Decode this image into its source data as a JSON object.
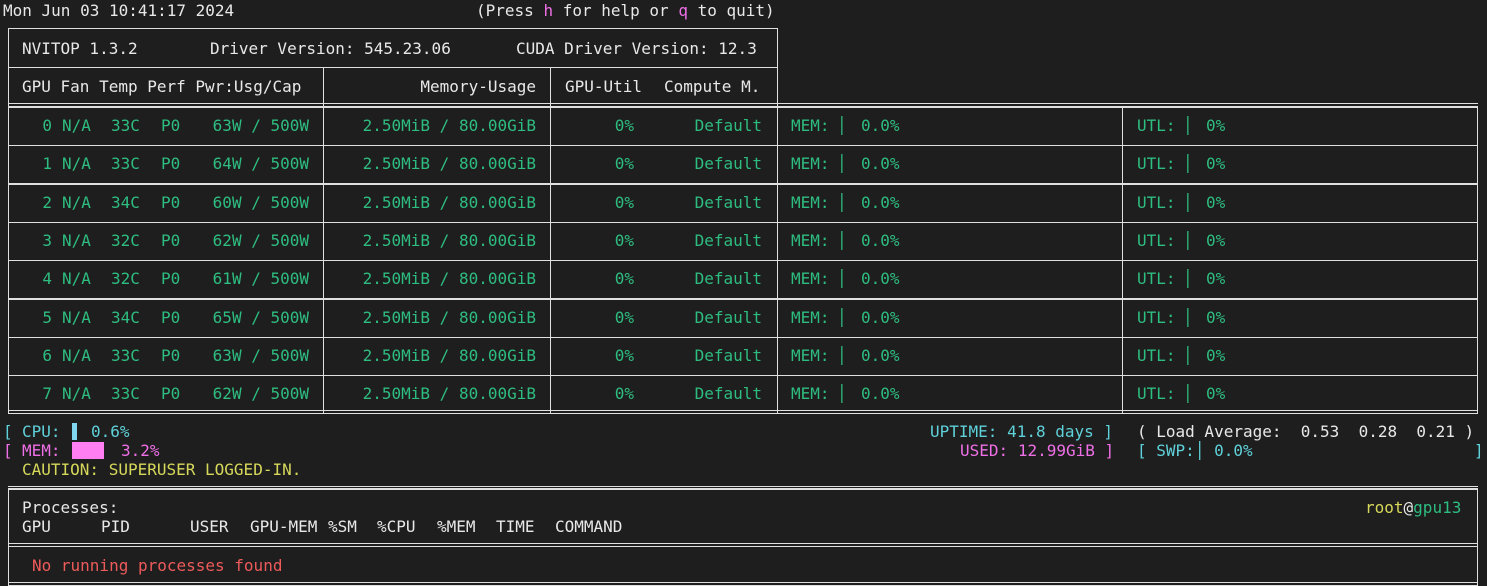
{
  "header": {
    "timestamp": "Mon Jun 03 10:41:17 2024",
    "help_prefix": "(Press ",
    "help_key": "h",
    "help_mid": " for help or ",
    "quit_key": "q",
    "help_suffix": " to quit)"
  },
  "info": {
    "nvitop_version": "NVITOP 1.3.2",
    "driver_version": "Driver Version: 545.23.06",
    "cuda_version": "CUDA Driver Version: 12.3"
  },
  "columns": {
    "gpu_fan_temp_perf_pwr": "GPU Fan Temp Perf Pwr:Usg/Cap",
    "memory_usage": "Memory-Usage",
    "gpu_util": "GPU-Util",
    "compute_mode": "Compute M."
  },
  "gpus": [
    {
      "id": "0",
      "fan": "N/A",
      "temp": "33C",
      "perf": "P0",
      "pwr": "63W / 500W",
      "mem": "2.50MiB / 80.00GiB",
      "util": "0%",
      "mode": "Default",
      "mem_label": "MEM:",
      "mem_pct": "0.0%",
      "utl_label": "UTL:",
      "utl_pct": "0%"
    },
    {
      "id": "1",
      "fan": "N/A",
      "temp": "33C",
      "perf": "P0",
      "pwr": "64W / 500W",
      "mem": "2.50MiB / 80.00GiB",
      "util": "0%",
      "mode": "Default",
      "mem_label": "MEM:",
      "mem_pct": "0.0%",
      "utl_label": "UTL:",
      "utl_pct": "0%"
    },
    {
      "id": "2",
      "fan": "N/A",
      "temp": "34C",
      "perf": "P0",
      "pwr": "60W / 500W",
      "mem": "2.50MiB / 80.00GiB",
      "util": "0%",
      "mode": "Default",
      "mem_label": "MEM:",
      "mem_pct": "0.0%",
      "utl_label": "UTL:",
      "utl_pct": "0%"
    },
    {
      "id": "3",
      "fan": "N/A",
      "temp": "32C",
      "perf": "P0",
      "pwr": "62W / 500W",
      "mem": "2.50MiB / 80.00GiB",
      "util": "0%",
      "mode": "Default",
      "mem_label": "MEM:",
      "mem_pct": "0.0%",
      "utl_label": "UTL:",
      "utl_pct": "0%"
    },
    {
      "id": "4",
      "fan": "N/A",
      "temp": "32C",
      "perf": "P0",
      "pwr": "61W / 500W",
      "mem": "2.50MiB / 80.00GiB",
      "util": "0%",
      "mode": "Default",
      "mem_label": "MEM:",
      "mem_pct": "0.0%",
      "utl_label": "UTL:",
      "utl_pct": "0%"
    },
    {
      "id": "5",
      "fan": "N/A",
      "temp": "34C",
      "perf": "P0",
      "pwr": "65W / 500W",
      "mem": "2.50MiB / 80.00GiB",
      "util": "0%",
      "mode": "Default",
      "mem_label": "MEM:",
      "mem_pct": "0.0%",
      "utl_label": "UTL:",
      "utl_pct": "0%"
    },
    {
      "id": "6",
      "fan": "N/A",
      "temp": "33C",
      "perf": "P0",
      "pwr": "63W / 500W",
      "mem": "2.50MiB / 80.00GiB",
      "util": "0%",
      "mode": "Default",
      "mem_label": "MEM:",
      "mem_pct": "0.0%",
      "utl_label": "UTL:",
      "utl_pct": "0%"
    },
    {
      "id": "7",
      "fan": "N/A",
      "temp": "33C",
      "perf": "P0",
      "pwr": "62W / 500W",
      "mem": "2.50MiB / 80.00GiB",
      "util": "0%",
      "mode": "Default",
      "mem_label": "MEM:",
      "mem_pct": "0.0%",
      "utl_label": "UTL:",
      "utl_pct": "0%"
    }
  ],
  "host": {
    "cpu_label": "CPU:",
    "cpu_pct": "0.6%",
    "cpu_fraction": 0.006,
    "mem_label": "MEM:",
    "mem_pct": "3.2%",
    "mem_fraction": 0.032,
    "caution": "CAUTION: SUPERUSER LOGGED-IN.",
    "uptime_label": "UPTIME:",
    "uptime_value": "41.8 days",
    "used_label": "USED:",
    "used_value": "12.99GiB",
    "load_label": "( Load Average:",
    "load_values": "0.53  0.28  0.21 )",
    "swp_label": "SWP:",
    "swp_pct": "0.0%",
    "bracket_open": "[",
    "bracket_close": "]"
  },
  "processes": {
    "title": "Processes:",
    "user": "root",
    "at": "@",
    "host": "gpu13",
    "columns": [
      "GPU",
      "PID",
      "USER",
      "GPU-MEM",
      "%SM",
      "%CPU",
      "%MEM",
      "TIME",
      "COMMAND"
    ],
    "empty_message": "No running processes found"
  },
  "colors": {
    "background": "#1e1e1e",
    "green": "#2ebd80",
    "cyan": "#5fd1d9",
    "magenta": "#ee6fe6",
    "yellow": "#d6d85a",
    "red": "#ee5a5a"
  }
}
